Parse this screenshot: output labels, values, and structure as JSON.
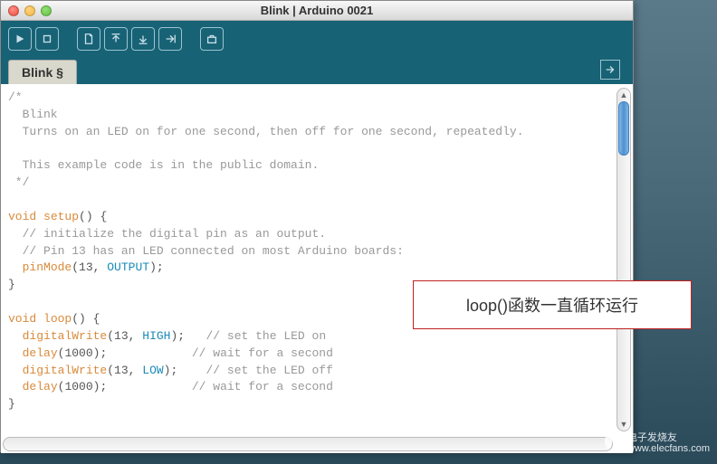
{
  "window": {
    "title": "Blink | Arduino 0021"
  },
  "toolbar": {
    "buttons": [
      "verify",
      "stop",
      "new",
      "open",
      "save",
      "upload",
      "serial-monitor"
    ]
  },
  "tab": {
    "label": "Blink §"
  },
  "code": {
    "c1": "/*",
    "c2": "  Blink",
    "c3": "  Turns on an LED on for one second, then off for one second, repeatedly.",
    "c4": " ",
    "c5": "  This example code is in the public domain.",
    "c6": " */",
    "blank": "",
    "void": "void",
    "setup": "setup",
    "loop": "loop",
    "paren_open": "()",
    "brace_open": " {",
    "brace_close": "}",
    "setup_c1": "  // initialize the digital pin as an output.",
    "setup_c2": "  // Pin 13 has an LED connected on most Arduino boards:",
    "pinMode": "pinMode",
    "pinMode_args_open": "(",
    "pin13": "13",
    "comma_sp": ", ",
    "OUTPUT": "OUTPUT",
    "close_stmt": ");",
    "digitalWrite": "digitalWrite",
    "HIGH": "HIGH",
    "LOW": "LOW",
    "delay": "delay",
    "delay_arg": "1000",
    "cmt_on": "// set the LED on",
    "cmt_off": "// set the LED off",
    "cmt_wait": "// wait for a second",
    "sp2": "  ",
    "sp_pad1": ");   ",
    "sp_pad2": ");            ",
    "sp_pad3": ");    "
  },
  "annotation": {
    "text": "loop()函数一直循环运行"
  },
  "watermark": {
    "line1": "电子发烧友",
    "line2": "www.elecfans.com"
  }
}
